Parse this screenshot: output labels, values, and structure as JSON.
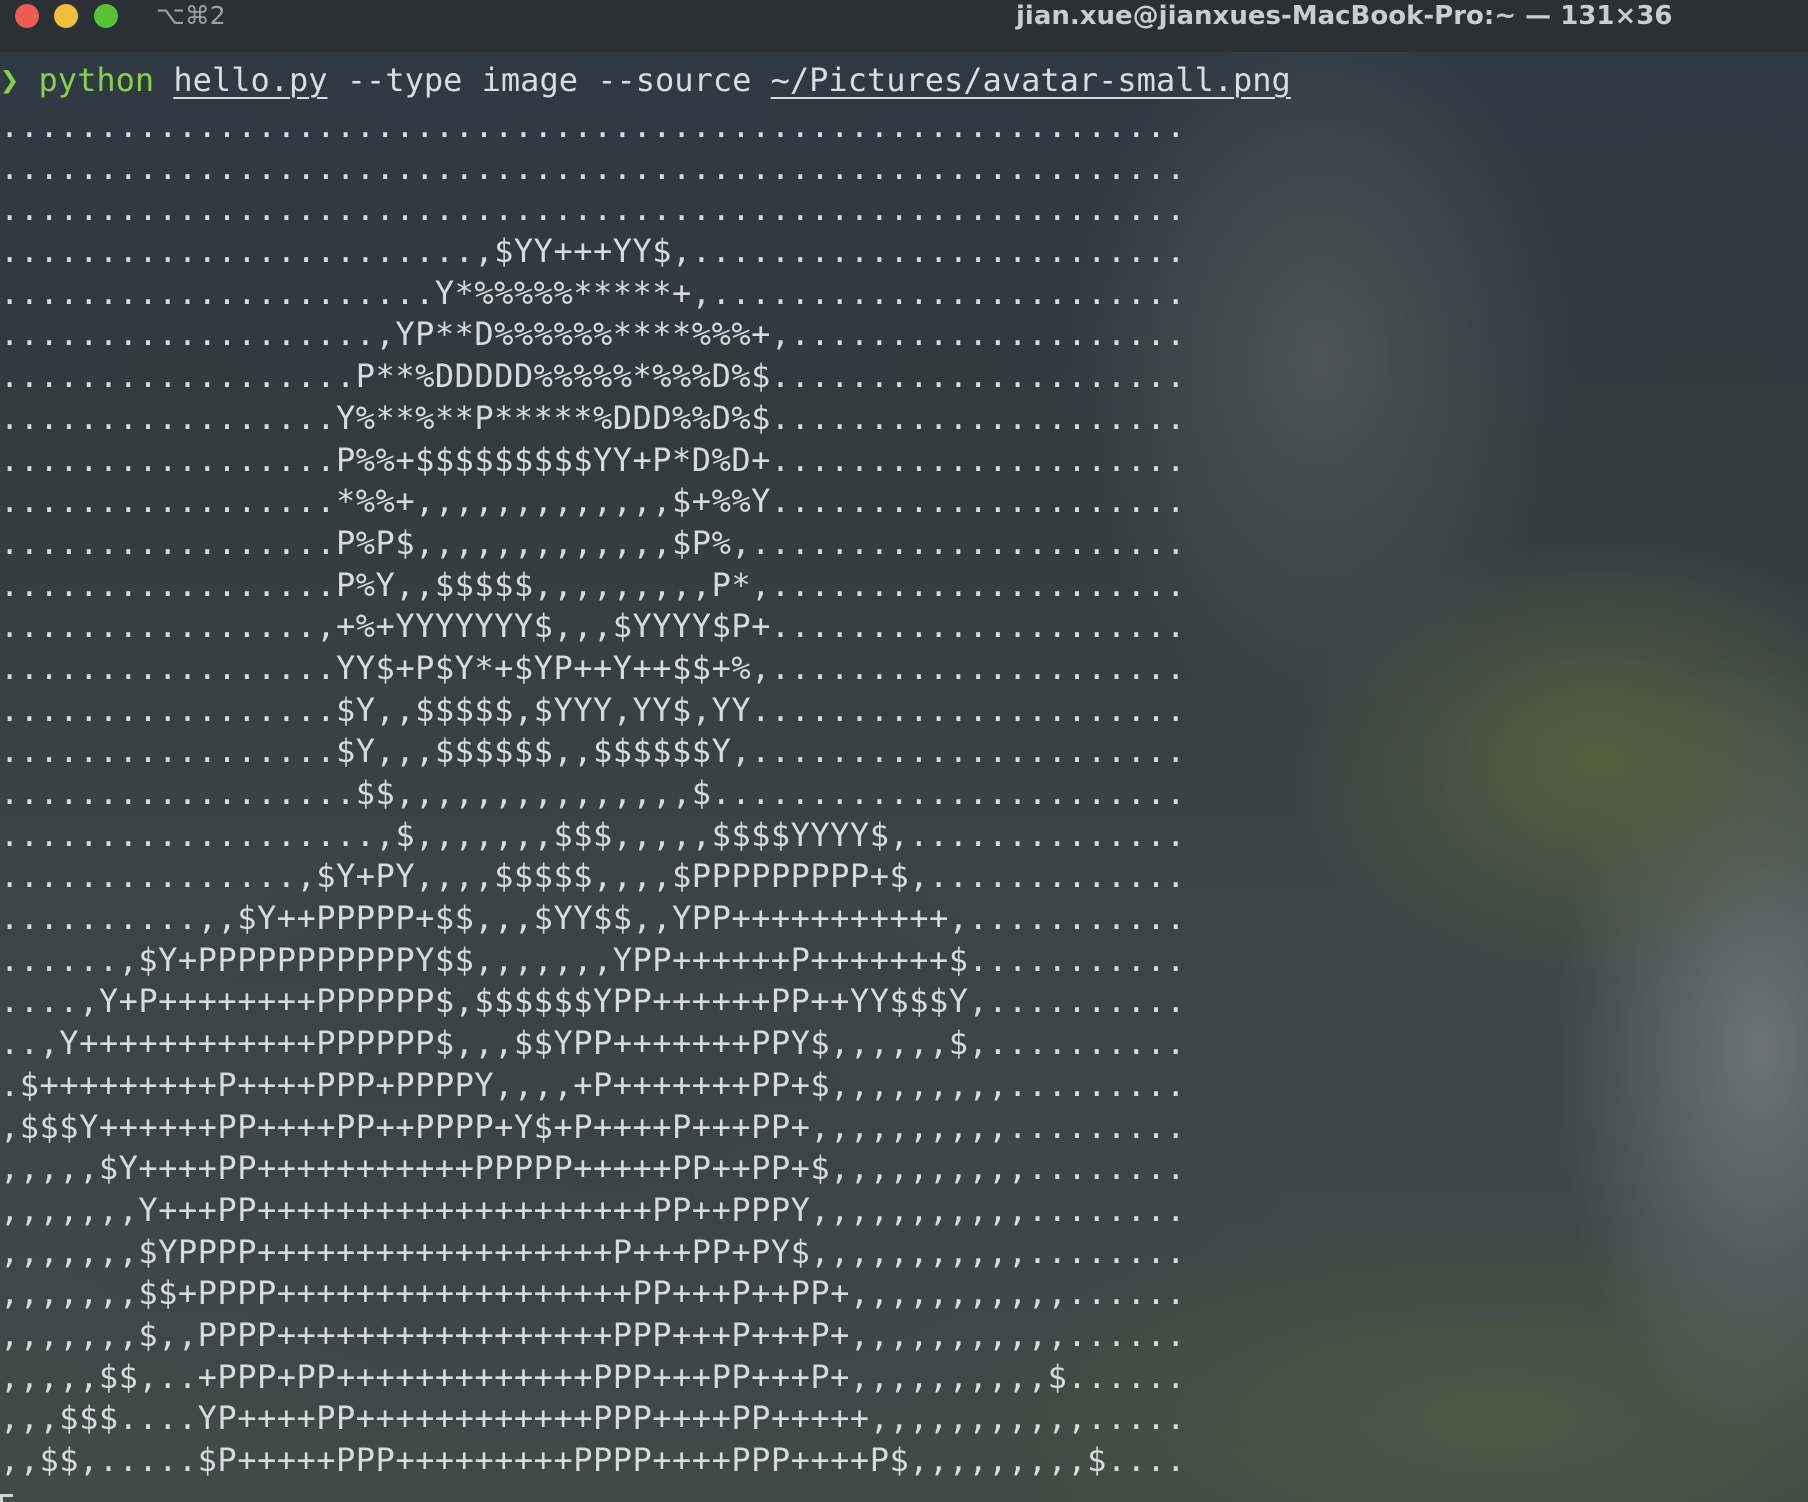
{
  "window": {
    "tab_shortcut": "⌥⌘2",
    "title": "jian.xue@jianxues-MacBook-Pro:~ — 131×36"
  },
  "command": {
    "prompt": "❯",
    "program": "python",
    "script": "hello.py",
    "flags": "--type image --source",
    "path": "~/Pictures/avatar-small.png"
  },
  "ascii_rows": [
    "............................................................",
    "............................................................",
    "............................................................",
    "........................,$YY+++YY$,.........................",
    "......................Y*%%%%%*****+,........................",
    "...................,YP**D%%%%%%****%%%+,....................",
    "..................P**%DDDDD%%%%%*%%%D%$.....................",
    ".................Y%**%**P*****%DDD%%D%$.....................",
    ".................P%%+$$$$$$$$$YY+P*D%D+.....................",
    ".................*%%+,,,,,,,,,,,,,$+%%Y.....................",
    ".................P%P$,,,,,,,,,,,,,$P%,......................",
    ".................P%Y,,$$$$$,,,,,,,,,P*,.....................",
    "................,+%+YYYYYYY$,,,$YYYY$P+.....................",
    ".................YY$+P$Y*+$YP++Y++$$+%,.....................",
    ".................$Y,,$$$$$,$YYY,YY$,YY......................",
    ".................$Y,,,$$$$$$,,$$$$$$Y,......................",
    "..................$$,,,,,,,,,,,,,,,$........................",
    "...................,$,,,,,,,$$$,,,,,$$$$YYYY$,..............",
    "...............,$Y+PY,,,,$$$$$,,,,$PPPPPPPPP+$,.............",
    "..........,,$Y++PPPPP+$$,,,$YY$$,,YPP+++++++++++,...........",
    "......,$Y+PPPPPPPPPPPY$$,,,,,,,YPP++++++P+++++++$...........",
    "....,Y+P++++++++PPPPPP$,$$$$$$YPP++++++PP++YY$$$Y,..........",
    "..,Y++++++++++++PPPPPP$,,,$$YPP+++++++PPY$,,,,,,$,..........",
    ".$+++++++++P++++PPP+PPPPY,,,,+P+++++++PP+$,,,,,,,,,.........",
    ",$$$Y++++++PP++++PP++PPPP+Y$+P++++P+++PP+,,,,,,,,,,.........",
    ",,,,,$Y++++PP+++++++++++PPPPP+++++PP++PP+$,,,,,,,,,,........",
    ",,,,,,,Y+++PP++++++++++++++++++++PP++PPPY,,,,,,,,,,,........",
    ",,,,,,,$YPPPP++++++++++++++++++P+++PP+PY$,,,,,,,,,,,........",
    ",,,,,,,$$+PPPP++++++++++++++++++PP+++P++PP+,,,,,,,,,,,......",
    ",,,,,,,$,,PPPP+++++++++++++++++PPP+++P+++P+,,,,,,,,,,,......",
    ",,,,,$$,..+PPP+PP+++++++++++++PPP+++PP+++P+,,,,,,,,,,$......",
    ",,,$$$....YP++++PP++++++++++++PPP++++PP+++++,,,,,,,,,,,.....",
    ",,$$,.....$P+++++PPP+++++++++PPPP++++PPP++++P$,,,,,,,,,$...."
  ]
}
